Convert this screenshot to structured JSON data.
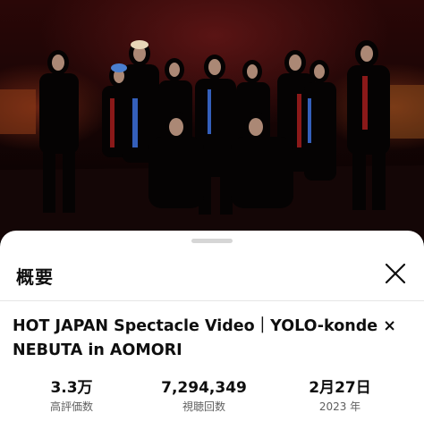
{
  "video": {
    "description_title": "概要",
    "close_icon": "close-icon"
  },
  "details": {
    "title": "HOT JAPAN Spectacle Video｜YOLO-konde × NEBUTA in AOMORI"
  },
  "stats": {
    "likes_value": "3.3万",
    "likes_label": "高評価数",
    "views_value": "7,294,349",
    "views_label": "視聴回数",
    "date_value": "2月27日",
    "date_label": "2023 年"
  },
  "colors": {
    "sheet_background": "#ffffff",
    "primary_text": "#0f0f0f",
    "secondary_text": "#606060",
    "divider": "#e5e5e5"
  }
}
